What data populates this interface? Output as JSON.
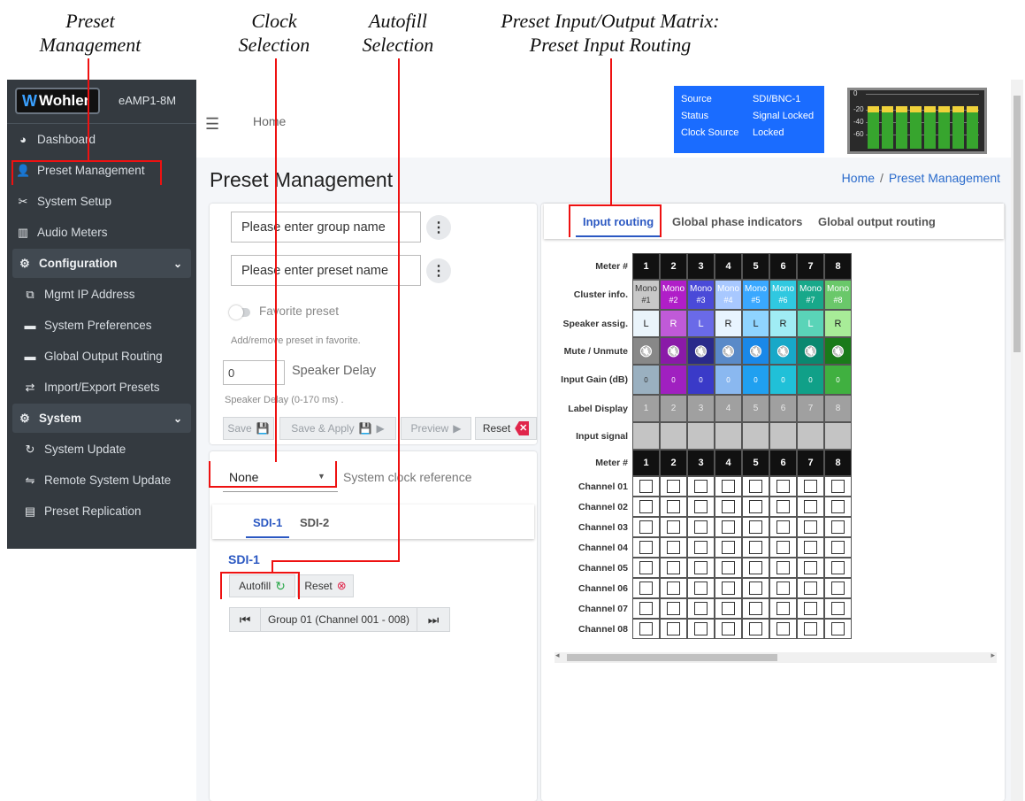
{
  "callouts": {
    "preset_management": [
      "Preset",
      "Management"
    ],
    "clock_selection": [
      "Clock",
      "Selection"
    ],
    "autofill_selection": [
      "Autofill",
      "Selection"
    ],
    "matrix": [
      "Preset Input/Output Matrix:",
      "Preset Input Routing"
    ]
  },
  "brand": {
    "logo": "Wohler",
    "model": "eAMP1-8M"
  },
  "sidebar": {
    "items": [
      {
        "label": "Dashboard",
        "icon": "dashboard-icon",
        "glyph": "◕"
      },
      {
        "label": "Preset Management",
        "icon": "user-edit-icon",
        "glyph": "👤"
      },
      {
        "label": "System Setup",
        "icon": "tools-icon",
        "glyph": "✂"
      },
      {
        "label": "Audio Meters",
        "icon": "bar-chart-icon",
        "glyph": "▥"
      },
      {
        "label": "Configuration",
        "icon": "gear-icon",
        "glyph": "⚙",
        "header": true
      },
      {
        "label": "Mgmt IP Address",
        "icon": "network-icon",
        "glyph": "⧉"
      },
      {
        "label": "System Preferences",
        "icon": "keyboard-icon",
        "glyph": "▬"
      },
      {
        "label": "Global Output Routing",
        "icon": "keyboard-icon",
        "glyph": "▬"
      },
      {
        "label": "Import/Export Presets",
        "icon": "exchange-icon",
        "glyph": "⇄"
      },
      {
        "label": "System",
        "icon": "gears-icon",
        "glyph": "⚙",
        "header": true
      },
      {
        "label": "System Update",
        "icon": "refresh-icon",
        "glyph": "↻"
      },
      {
        "label": "Remote System Update",
        "icon": "remote-icon",
        "glyph": "⇋"
      },
      {
        "label": "Preset Replication",
        "icon": "copy-icon",
        "glyph": "▤"
      }
    ]
  },
  "topbar": {
    "home": "Home",
    "source": {
      "k1": "Source",
      "v1": "SDI/BNC-1",
      "k2": "Status",
      "v2": "Signal Locked",
      "k3": "Clock Source",
      "v3": "Locked"
    },
    "meter_labels": [
      "0",
      "-20",
      "-40",
      "-60"
    ],
    "meter_levels": [
      0.95,
      0.95,
      0.95,
      0.95,
      0.95,
      0.95,
      0.95,
      0.95
    ],
    "meter_peak": [
      0.83,
      0.83,
      0.83,
      0.83,
      0.8,
      0.8,
      0.8,
      0.8
    ]
  },
  "page": {
    "title": "Preset Management",
    "crumb_home": "Home",
    "crumb_sep": "/",
    "crumb_current": "Preset Management"
  },
  "form": {
    "group_placeholder": "Please enter group name",
    "preset_placeholder": "Please enter preset name",
    "favorite_label": "Favorite preset",
    "favorite_help": "Add/remove preset in favorite.",
    "delay_value": "0",
    "delay_label": "Speaker Delay",
    "delay_help": "Speaker Delay (0-170 ms) .",
    "save": "Save",
    "save_apply": "Save & Apply",
    "preview": "Preview",
    "reset": "Reset"
  },
  "clock": {
    "selected": "None",
    "label": "System clock reference"
  },
  "sdi": {
    "tabs": [
      "SDI-1",
      "SDI-2"
    ],
    "heading": "SDI-1",
    "autofill": "Autofill",
    "reset": "Reset",
    "group": "Group 01 (Channel 001 - 008)"
  },
  "routing": {
    "tabs": [
      "Input routing",
      "Global phase indicators",
      "Global output routing"
    ],
    "row_labels": {
      "meter": "Meter #",
      "cluster": "Cluster info.",
      "speaker": "Speaker assig.",
      "mute": "Mute / Unmute",
      "gain": "Input Gain (dB)",
      "label": "Label Display",
      "signal": "Input signal"
    },
    "meters": [
      "1",
      "2",
      "3",
      "4",
      "5",
      "6",
      "7",
      "8"
    ],
    "cluster_top": [
      "Mono",
      "Mono",
      "Mono",
      "Mono",
      "Mono",
      "Mono",
      "Mono",
      "Mono"
    ],
    "cluster_bottom": [
      "#1",
      "#2",
      "#3",
      "#4",
      "#5",
      "#6",
      "#7",
      "#8"
    ],
    "cluster_colors": [
      "#c8c8c8",
      "#b01ec8",
      "#4a4ad8",
      "#a8c8ff",
      "#3aa8ff",
      "#30c8e0",
      "#18a88a",
      "#6ac86a"
    ],
    "speakers": [
      "L",
      "R",
      "L",
      "R",
      "L",
      "R",
      "L",
      "R"
    ],
    "speaker_colors": [
      "#eaf4fb",
      "#c05ad8",
      "#6a6ae8",
      "#e8f4ff",
      "#8fd4ff",
      "#a0ecf4",
      "#5ad4b8",
      "#a8ec98"
    ],
    "mute_colors": [
      "#888888",
      "#8a1aa8",
      "#2a2a8a",
      "#5a8ac8",
      "#1a88e8",
      "#18a8c8",
      "#0a8870",
      "#1a7a1a"
    ],
    "gains": [
      "0",
      "0",
      "0",
      "0",
      "0",
      "0",
      "0",
      "0"
    ],
    "gain_colors": [
      "#9ab0c0",
      "#a020c0",
      "#3a3ac8",
      "#8ab8f0",
      "#20a0f0",
      "#20c0d8",
      "#10a088",
      "#40b040"
    ],
    "labels": [
      "1",
      "2",
      "3",
      "4",
      "5",
      "6",
      "7",
      "8"
    ],
    "channels": [
      "Channel 01",
      "Channel 02",
      "Channel 03",
      "Channel 04",
      "Channel 05",
      "Channel 06",
      "Channel 07",
      "Channel 08"
    ]
  }
}
